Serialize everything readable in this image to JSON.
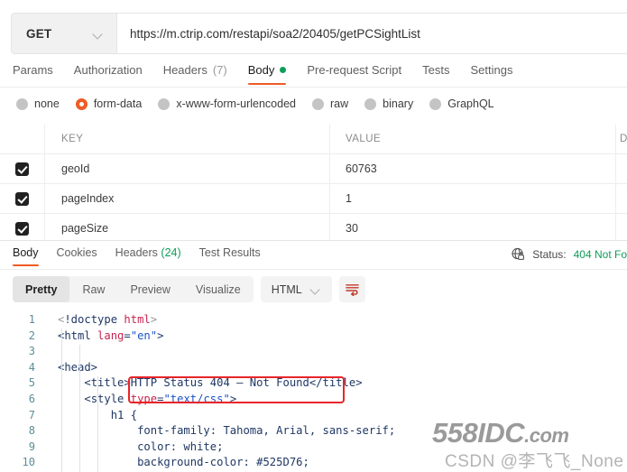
{
  "request": {
    "method": "GET",
    "url": "https://m.ctrip.com/restapi/soa2/20405/getPCSightList",
    "tabs": [
      {
        "label": "Params",
        "count": "",
        "active": false,
        "dot": false
      },
      {
        "label": "Authorization",
        "count": "",
        "active": false,
        "dot": false
      },
      {
        "label": "Headers",
        "count": "(7)",
        "active": false,
        "dot": false
      },
      {
        "label": "Body",
        "count": "",
        "active": true,
        "dot": true
      },
      {
        "label": "Pre-request Script",
        "count": "",
        "active": false,
        "dot": false
      },
      {
        "label": "Tests",
        "count": "",
        "active": false,
        "dot": false
      },
      {
        "label": "Settings",
        "count": "",
        "active": false,
        "dot": false
      }
    ],
    "body_types": [
      {
        "label": "none",
        "selected": false
      },
      {
        "label": "form-data",
        "selected": true
      },
      {
        "label": "x-www-form-urlencoded",
        "selected": false
      },
      {
        "label": "raw",
        "selected": false
      },
      {
        "label": "binary",
        "selected": false
      },
      {
        "label": "GraphQL",
        "selected": false
      }
    ],
    "table": {
      "headers": {
        "key": "KEY",
        "value": "VALUE",
        "description": "D"
      },
      "rows": [
        {
          "checked": true,
          "key": "geoId",
          "value": "60763"
        },
        {
          "checked": true,
          "key": "pageIndex",
          "value": "1"
        },
        {
          "checked": true,
          "key": "pageSize",
          "value": "30"
        }
      ]
    }
  },
  "response": {
    "tabs": [
      {
        "label": "Body",
        "count": "",
        "active": true
      },
      {
        "label": "Cookies",
        "count": "",
        "active": false
      },
      {
        "label": "Headers",
        "count": "(24)",
        "active": false
      },
      {
        "label": "Test Results",
        "count": "",
        "active": false
      }
    ],
    "status_label": "Status:",
    "status_value": "404 Not Fo",
    "view_modes": [
      {
        "label": "Pretty",
        "active": true
      },
      {
        "label": "Raw",
        "active": false
      },
      {
        "label": "Preview",
        "active": false
      },
      {
        "label": "Visualize",
        "active": false
      }
    ],
    "language": "HTML",
    "code_lines": [
      {
        "n": "1",
        "html": "<span class='tk-dim'>&lt;</span><span class='tk-tag'>!doctype </span><span class='tk-attr'>html</span><span class='tk-dim'>&gt;</span>"
      },
      {
        "n": "2",
        "html": "<span class='tk-tag'>&lt;html </span><span class='tk-attr'>lang</span><span class='tk-tag'>=</span><span class='tk-str'>\"en\"</span><span class='tk-tag'>&gt;</span>"
      },
      {
        "n": "3",
        "html": ""
      },
      {
        "n": "4",
        "html": "<span class='tk-tag'>&lt;head&gt;</span>"
      },
      {
        "n": "5",
        "html": "    <span class='tk-tag'>&lt;title&gt;HTTP Status 404 &#8211; Not Found&lt;/title&gt;</span>"
      },
      {
        "n": "6",
        "html": "    <span class='tk-tag'>&lt;style </span><span class='tk-attr'>type</span><span class='tk-tag'>=</span><span class='tk-str'>\"text/css\"</span><span class='tk-tag'>&gt;</span>"
      },
      {
        "n": "7",
        "html": "        <span class='tk-tag'>h1 {</span>"
      },
      {
        "n": "8",
        "html": "            <span class='tk-tag'>font-family: Tahoma, Arial, sans-serif;</span>"
      },
      {
        "n": "9",
        "html": "            <span class='tk-tag'>color: white;</span>"
      },
      {
        "n": "10",
        "html": "            <span class='tk-tag'>background-color: #525D76;</span>"
      }
    ]
  },
  "watermark": {
    "primary": "558IDC",
    "primary_suffix": ".com",
    "secondary": "CSDN @李飞飞_None"
  },
  "colors": {
    "accent": "#ef5b25",
    "success": "#0f9d58",
    "annotation": "#e8252a",
    "checkbox": "#212121"
  }
}
